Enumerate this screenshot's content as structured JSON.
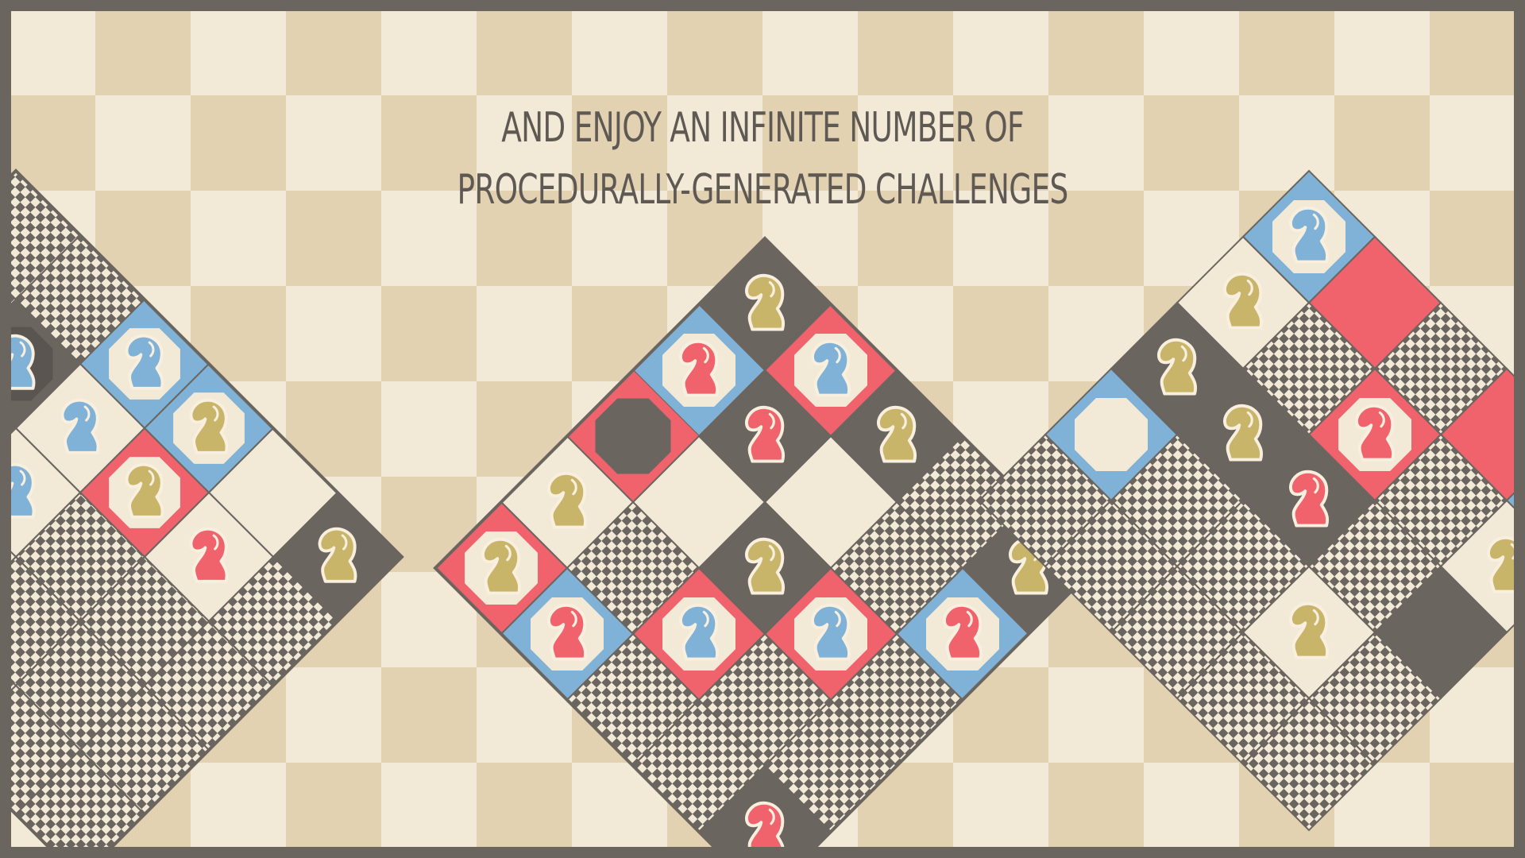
{
  "caption": {
    "line1": "AND ENJOY AN INFINITE NUMBER OF",
    "line2": "PROCEDURALLY-GENERATED CHALLENGES"
  },
  "colors": {
    "background_light": "#f3e9d7",
    "background_dark": "#e3d2b2",
    "frame": "#6b6560",
    "dark_tile": "#6b6560",
    "light_tile": "#f3e9d7",
    "gold_knight": "#c8b56a",
    "blue_knight": "#7fb2d6",
    "red_knight": "#f0626c",
    "blue_accent": "#7fb2d6",
    "red_accent": "#f0626c"
  },
  "boards": [
    {
      "name": "left-board",
      "cells": [
        [
          "fine",
          "fine",
          "blue-hex:blue",
          "blue-hex:gold",
          "light",
          "dark:gold"
        ],
        [
          "fine",
          "dark-hex:blue",
          "light:blue",
          "red-hex:gold",
          "light:red",
          "fine"
        ],
        [
          "red",
          "dark:gold",
          "light:blue",
          "fine",
          "fine",
          "fine"
        ],
        [
          "blue-hex:gold",
          "light:gold",
          "light",
          "fine",
          "fine",
          "fine"
        ],
        [
          "dark:red",
          "fine",
          "fine",
          "fine",
          "fine",
          "fine"
        ]
      ]
    },
    {
      "name": "center-board",
      "cells": [
        [
          "dark:gold",
          "red-hex:blue",
          "dark:gold",
          "fine",
          "dark:gold"
        ],
        [
          "blue-hex:red",
          "dark:red",
          "light",
          "fine",
          "blue-hex:red"
        ],
        [
          "red-dark-hex",
          "light",
          "dark:gold",
          "red-hex:blue",
          "fine"
        ],
        [
          "light:gold",
          "fine",
          "red-hex:blue",
          "fine",
          "fine"
        ],
        [
          "red-hex:gold",
          "blue-hex:red",
          "fine",
          "fine",
          "dark:red"
        ]
      ]
    },
    {
      "name": "right-board",
      "cells": [
        [
          "blue-hex:blue",
          "red",
          "fine",
          "red",
          "blue-hex:light"
        ],
        [
          "light:gold",
          "fine",
          "red-hex:red",
          "fine",
          "light:gold"
        ],
        [
          "dark:gold",
          "dark:gold",
          "dark:red",
          "fine",
          "dark"
        ],
        [
          "blue-hex:light",
          "fine",
          "fine",
          "light:gold",
          "fine"
        ],
        [
          "fine",
          "fine",
          "fine",
          "fine",
          "fine"
        ]
      ]
    }
  ]
}
